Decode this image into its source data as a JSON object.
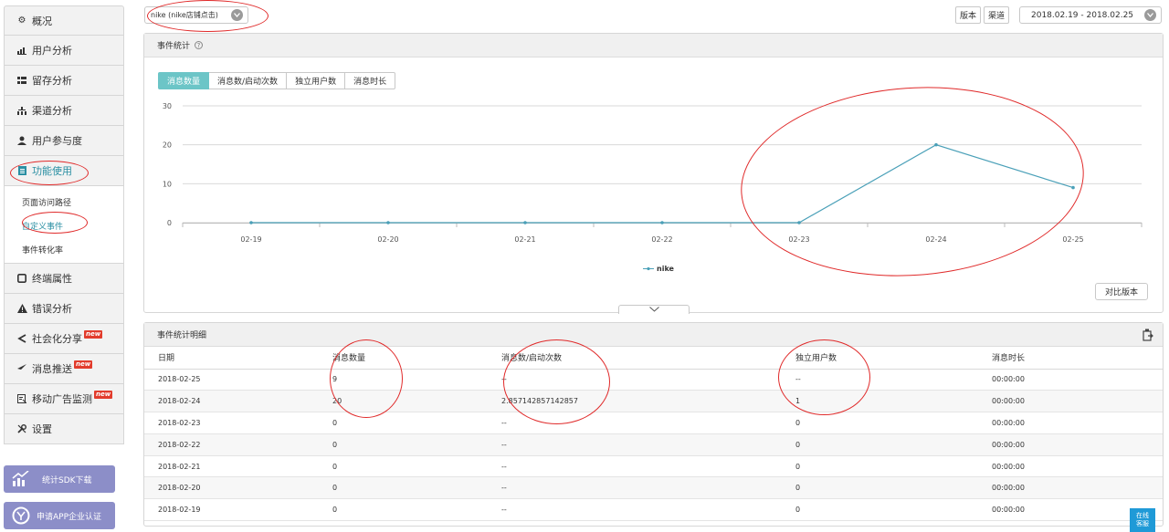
{
  "sidebar": {
    "items": [
      {
        "label": "概况",
        "icon": "gear-icon"
      },
      {
        "label": "用户分析",
        "icon": "bar-chart-icon"
      },
      {
        "label": "留存分析",
        "icon": "grid-icon"
      },
      {
        "label": "渠道分析",
        "icon": "sitemap-icon"
      },
      {
        "label": "用户参与度",
        "icon": "user-icon"
      },
      {
        "label": "功能使用",
        "icon": "document-icon"
      }
    ],
    "sub_items": [
      {
        "label": "页面访问路径"
      },
      {
        "label": "自定义事件"
      },
      {
        "label": "事件转化率"
      }
    ],
    "items_after": [
      {
        "label": "终端属性",
        "icon": "square-icon",
        "new": ""
      },
      {
        "label": "错误分析",
        "icon": "warning-icon",
        "new": ""
      },
      {
        "label": "社会化分享",
        "icon": "share-icon",
        "new": "new"
      },
      {
        "label": "消息推送",
        "icon": "send-icon",
        "new": "new"
      },
      {
        "label": "移动广告监测",
        "icon": "ad-icon",
        "new": "new"
      },
      {
        "label": "设置",
        "icon": "wrench-icon",
        "new": ""
      }
    ],
    "promo": {
      "sdk_label": "统计SDK下载",
      "cert_label": "申请APP企业认证"
    }
  },
  "topbar": {
    "event_selector": "nike (nike店铺点击)",
    "version_btn": "版本",
    "channel_btn": "渠道",
    "date_range": "2018.02.19 - 2018.02.25"
  },
  "stats_panel": {
    "title": "事件统计",
    "tabs": [
      "消息数量",
      "消息数/启动次数",
      "独立用户数",
      "消息时长"
    ],
    "active_tab": 0,
    "compare_btn": "对比版本"
  },
  "chart_data": {
    "type": "line",
    "categories": [
      "02-19",
      "02-20",
      "02-21",
      "02-22",
      "02-23",
      "02-24",
      "02-25"
    ],
    "series": [
      {
        "name": "nike",
        "values": [
          0,
          0,
          0,
          0,
          0,
          20,
          9
        ],
        "color": "#4aa0b8"
      }
    ],
    "yticks": [
      0,
      10,
      20,
      30
    ],
    "ylim": [
      0,
      30
    ],
    "grid": true,
    "legend": "bottom-center"
  },
  "detail_panel": {
    "title": "事件统计明细",
    "columns": [
      "日期",
      "消息数量",
      "消息数/启动次数",
      "独立用户数",
      "消息时长"
    ],
    "rows": [
      [
        "2018-02-25",
        "9",
        "--",
        "--",
        "00:00:00"
      ],
      [
        "2018-02-24",
        "20",
        "2.857142857142857",
        "1",
        "00:00:00"
      ],
      [
        "2018-02-23",
        "0",
        "--",
        "0",
        "00:00:00"
      ],
      [
        "2018-02-22",
        "0",
        "--",
        "0",
        "00:00:00"
      ],
      [
        "2018-02-21",
        "0",
        "--",
        "0",
        "00:00:00"
      ],
      [
        "2018-02-20",
        "0",
        "--",
        "0",
        "00:00:00"
      ],
      [
        "2018-02-19",
        "0",
        "--",
        "0",
        "00:00:00"
      ]
    ]
  },
  "online_chat": {
    "line1": "在线",
    "line2": "客服"
  }
}
